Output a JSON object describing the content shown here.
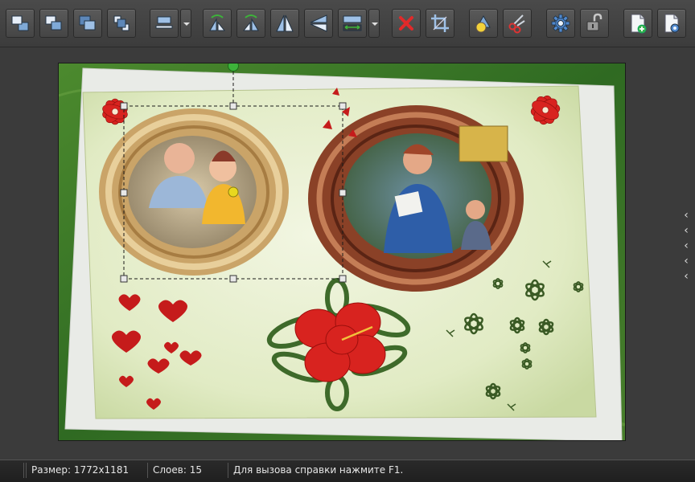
{
  "toolbar": {
    "buttons": [
      {
        "icon": "bring-to-front-icon"
      },
      {
        "icon": "bring-forward-icon"
      },
      {
        "icon": "send-backward-icon"
      },
      {
        "icon": "send-to-back-icon"
      },
      {
        "icon": "align-icon"
      },
      {
        "icon": "rotate-left-icon"
      },
      {
        "icon": "rotate-right-icon"
      },
      {
        "icon": "flip-horizontal-icon"
      },
      {
        "icon": "flip-vertical-icon"
      },
      {
        "icon": "stretch-icon"
      },
      {
        "icon": "delete-icon"
      },
      {
        "icon": "crop-icon"
      },
      {
        "icon": "effects-icon"
      },
      {
        "icon": "cut-icon"
      },
      {
        "icon": "settings-icon"
      },
      {
        "icon": "lock-icon"
      },
      {
        "icon": "new-page-icon"
      },
      {
        "icon": "page-settings-icon"
      }
    ]
  },
  "colors": {
    "background": "#3a3a3a",
    "toolbar": "#454545",
    "canvas_green": "#2f6a22",
    "paper": "#e6efcf",
    "flower_red": "#d8231f",
    "frame_light": "#d9b27a",
    "frame_dark": "#7a3a22",
    "selection_handle": "#e0e0e0",
    "rotate_handle": "#3db33a",
    "anchor": "#e8d81e"
  },
  "status": {
    "size_label": "Размер:",
    "size_value": "1772x1181",
    "layers_label": "Слоев:",
    "layers_value": "15",
    "hint": "Для вызова справки нажмите F1."
  }
}
